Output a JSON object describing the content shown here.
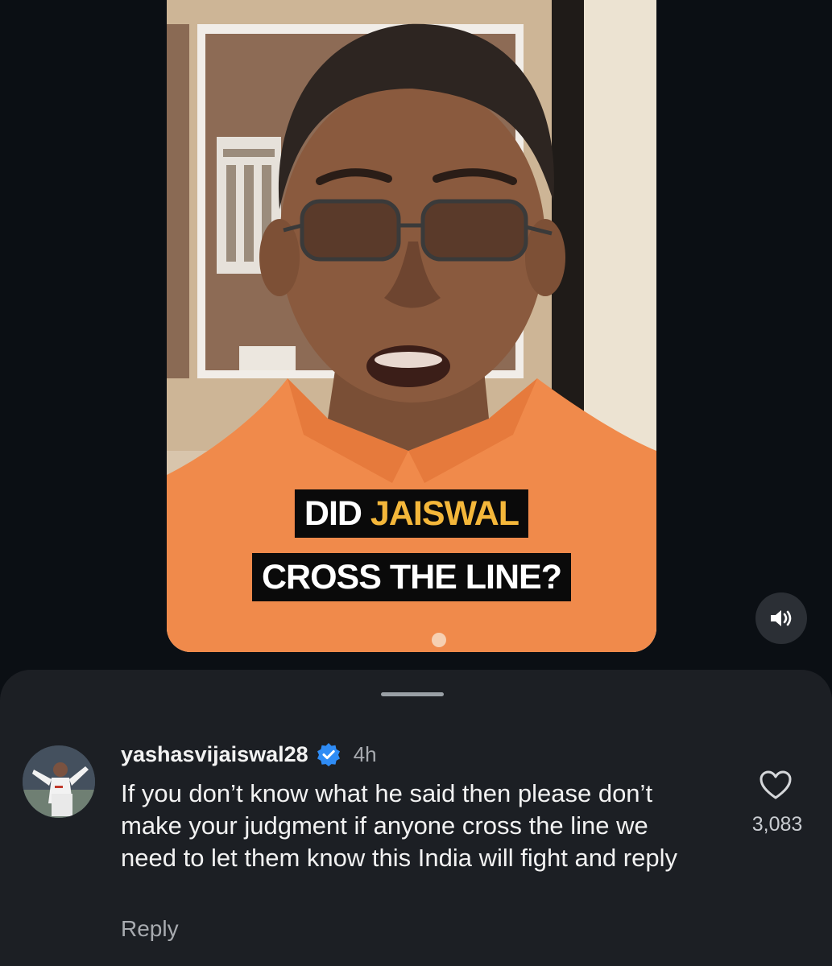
{
  "video": {
    "caption_line1_prefix": "DID ",
    "caption_line1_highlight": "JAISWAL",
    "caption_line2": "CROSS THE LINE?",
    "sound_icon": "speaker-volume-icon"
  },
  "comment": {
    "username": "yashasvijaiswal28",
    "verified_icon": "verified-badge-icon",
    "timestamp": "4h",
    "text": "If you don’t know what he said then please don’t make your judgment if  anyone cross the line we need to let them know this India will fight and reply",
    "reply_label": "Reply",
    "like_icon": "heart-icon",
    "like_count": "3,083"
  },
  "colors": {
    "background": "#0b0f14",
    "sheet": "#1c1f24",
    "caption_highlight": "#f4b73a",
    "verified_blue": "#2f8cf5",
    "shirt_orange": "#f08a4b"
  }
}
